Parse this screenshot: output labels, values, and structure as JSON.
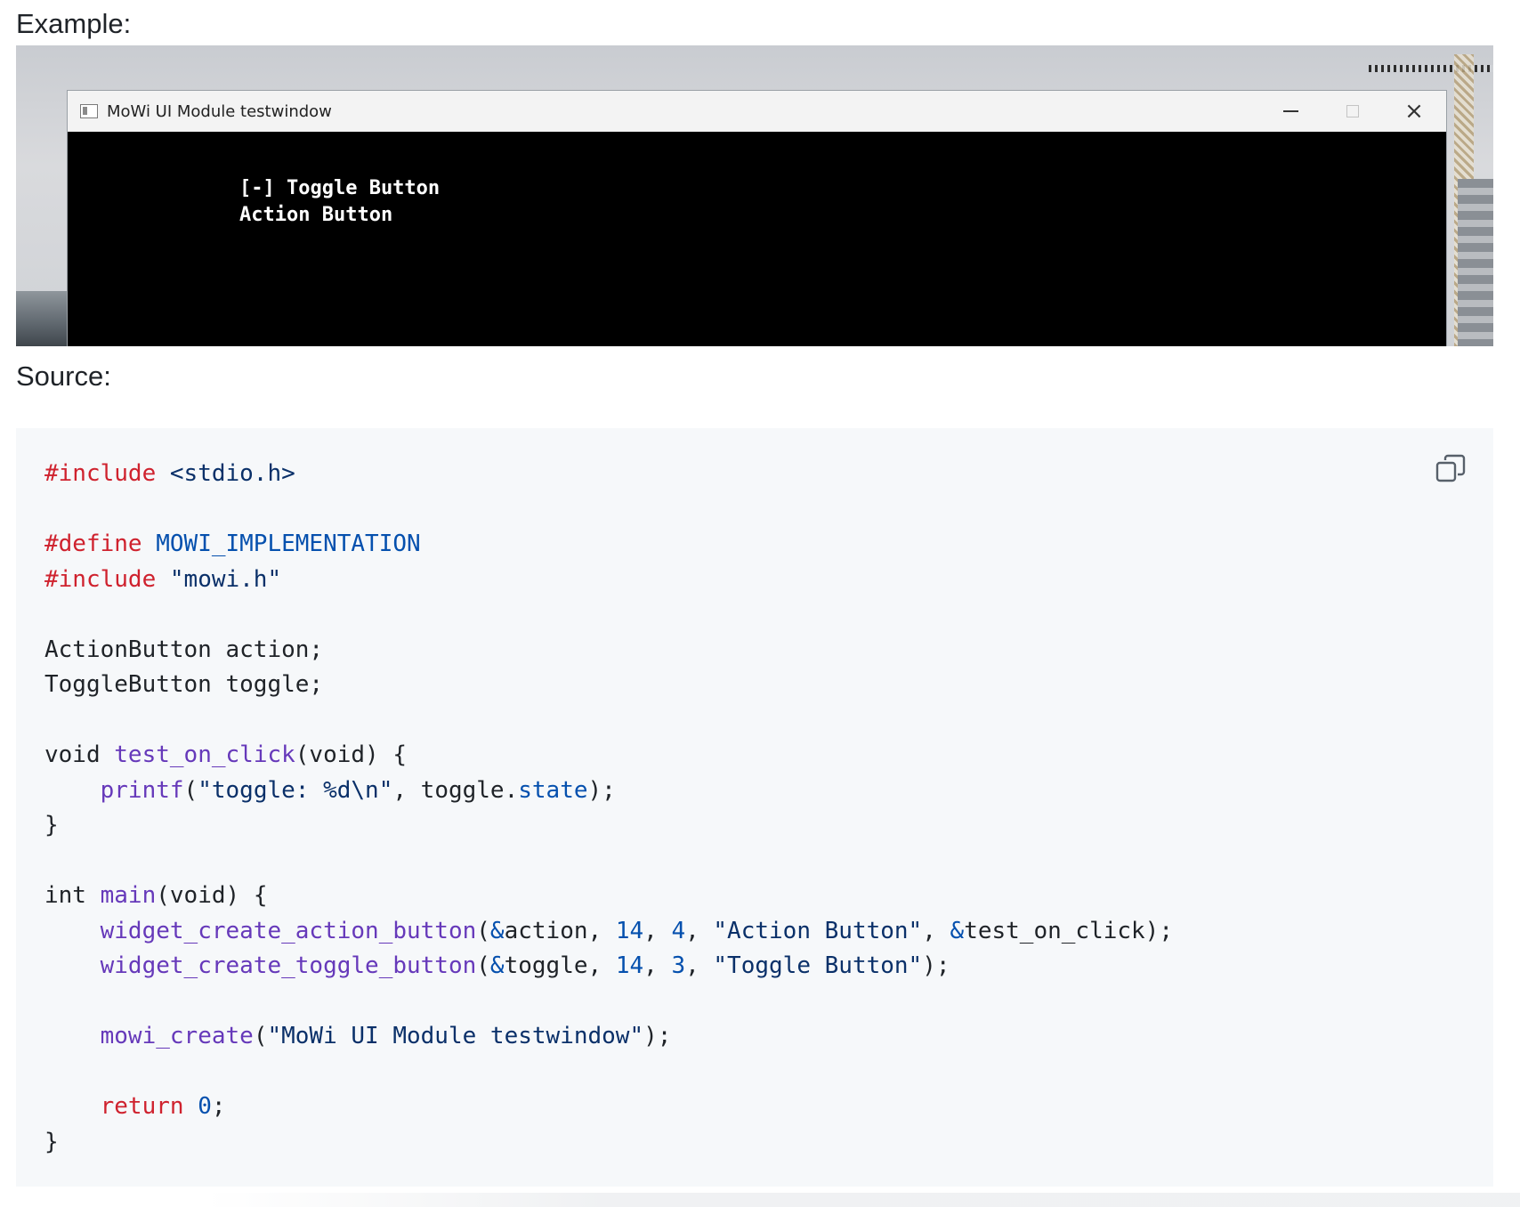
{
  "headings": {
    "example": "Example:",
    "source": "Source:"
  },
  "window": {
    "title": "MoWi UI Module testwindow",
    "controls": {
      "minimize": "minimize-icon",
      "maximize": "maximize-icon",
      "close": "×"
    },
    "console_lines": [
      "[-] Toggle Button",
      "Action Button"
    ]
  },
  "code": {
    "copy_icon": "copy-icon",
    "lines": [
      [
        {
          "t": "#include",
          "c": "kw"
        },
        {
          "t": " "
        },
        {
          "t": "<stdio.h>",
          "c": "st"
        }
      ],
      [],
      [
        {
          "t": "#define",
          "c": "kw"
        },
        {
          "t": " "
        },
        {
          "t": "MOWI_IMPLEMENTATION",
          "c": "mc"
        }
      ],
      [
        {
          "t": "#include",
          "c": "kw"
        },
        {
          "t": " "
        },
        {
          "t": "\"mowi.h\"",
          "c": "st"
        }
      ],
      [],
      [
        {
          "t": "ActionButton action;"
        }
      ],
      [
        {
          "t": "ToggleButton toggle;"
        }
      ],
      [],
      [
        {
          "t": "void "
        },
        {
          "t": "test_on_click",
          "c": "fn"
        },
        {
          "t": "(void) {"
        }
      ],
      [
        {
          "t": "    "
        },
        {
          "t": "printf",
          "c": "fn"
        },
        {
          "t": "("
        },
        {
          "t": "\"toggle: %d\\n\"",
          "c": "st"
        },
        {
          "t": ", toggle."
        },
        {
          "t": "state",
          "c": "pr"
        },
        {
          "t": ");"
        }
      ],
      [
        {
          "t": "}"
        }
      ],
      [],
      [
        {
          "t": "int "
        },
        {
          "t": "main",
          "c": "fn"
        },
        {
          "t": "(void) {"
        }
      ],
      [
        {
          "t": "    "
        },
        {
          "t": "widget_create_action_button",
          "c": "fn"
        },
        {
          "t": "("
        },
        {
          "t": "&",
          "c": "op"
        },
        {
          "t": "action, "
        },
        {
          "t": "14",
          "c": "nm"
        },
        {
          "t": ", "
        },
        {
          "t": "4",
          "c": "nm"
        },
        {
          "t": ", "
        },
        {
          "t": "\"Action Button\"",
          "c": "st"
        },
        {
          "t": ", "
        },
        {
          "t": "&",
          "c": "op"
        },
        {
          "t": "test_on_click);"
        }
      ],
      [
        {
          "t": "    "
        },
        {
          "t": "widget_create_toggle_button",
          "c": "fn"
        },
        {
          "t": "("
        },
        {
          "t": "&",
          "c": "op"
        },
        {
          "t": "toggle, "
        },
        {
          "t": "14",
          "c": "nm"
        },
        {
          "t": ", "
        },
        {
          "t": "3",
          "c": "nm"
        },
        {
          "t": ", "
        },
        {
          "t": "\"Toggle Button\"",
          "c": "st"
        },
        {
          "t": ");"
        }
      ],
      [],
      [
        {
          "t": "    "
        },
        {
          "t": "mowi_create",
          "c": "fn"
        },
        {
          "t": "("
        },
        {
          "t": "\"MoWi UI Module testwindow\"",
          "c": "st"
        },
        {
          "t": ");"
        }
      ],
      [],
      [
        {
          "t": "    "
        },
        {
          "t": "return",
          "c": "kw"
        },
        {
          "t": " "
        },
        {
          "t": "0",
          "c": "nm"
        },
        {
          "t": ";"
        }
      ],
      [
        {
          "t": "}"
        }
      ]
    ]
  }
}
